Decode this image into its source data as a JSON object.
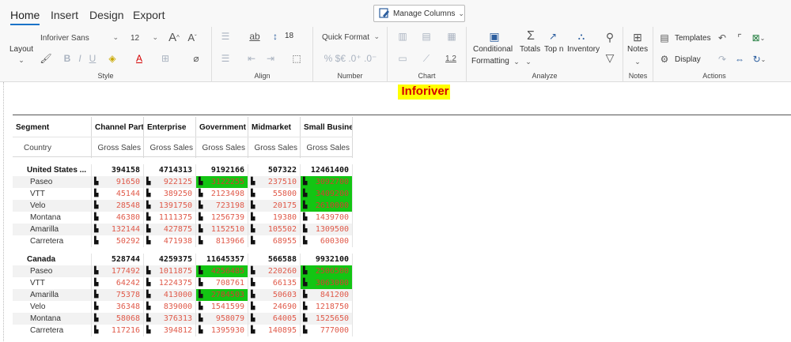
{
  "tabs": [
    "Home",
    "Insert",
    "Design",
    "Export"
  ],
  "manage_columns": "Manage Columns",
  "ribbon": {
    "layout_label": "Layout",
    "font_name": "Inforiver Sans",
    "font_size": "12",
    "line_height": "18",
    "quick_format": "Quick Format",
    "conditional_formatting": [
      "Conditional",
      "Formatting"
    ],
    "totals": "Totals",
    "topn": "Top n",
    "inventory": "Inventory",
    "notes": "Notes",
    "templates": "Templates",
    "display": "Display",
    "groups": [
      "Style",
      "Align",
      "Number",
      "Chart",
      "Analyze",
      "Notes",
      "Actions"
    ],
    "number_symbols": "% $€ .0⁺ .0⁻",
    "chart_ratio": "1.2"
  },
  "report_title": "Inforiver",
  "colors": {
    "accent": "#1a73c8",
    "title_red": "#d40000",
    "title_bg": "#ffff00",
    "highlight": "#13c513",
    "value_red": "#e05a4a"
  },
  "table": {
    "row_header": "Segment",
    "row_subheader": "Country",
    "columns": [
      "Channel Partners",
      "Enterprise",
      "Government",
      "Midmarket",
      "Small Business"
    ],
    "measure": "Gross Sales",
    "groups": [
      {
        "name": "United States ...",
        "totals": [
          "394158",
          "4714313",
          "9192166",
          "507322",
          "12461400"
        ],
        "rows": [
          {
            "label": "Paseo",
            "values": [
              "91650",
              "922125",
              "3122255",
              "237510",
              "3092700"
            ]
          },
          {
            "label": "VTT",
            "values": [
              "45144",
              "389250",
              "2123498",
              "55800",
              "3409200"
            ]
          },
          {
            "label": "Velo",
            "values": [
              "28548",
              "1391750",
              "723198",
              "20175",
              "2610000"
            ]
          },
          {
            "label": "Montana",
            "values": [
              "46380",
              "1111375",
              "1256739",
              "19380",
              "1439700"
            ]
          },
          {
            "label": "Amarilla",
            "values": [
              "132144",
              "427875",
              "1152510",
              "105502",
              "1309500"
            ]
          },
          {
            "label": "Carretera",
            "values": [
              "50292",
              "471938",
              "813966",
              "68955",
              "600300"
            ]
          }
        ]
      },
      {
        "name": "Canada",
        "totals": [
          "528744",
          "4259375",
          "11645357",
          "566588",
          "9932100"
        ],
        "rows": [
          {
            "label": "Paseo",
            "values": [
              "177492",
              "1011875",
              "4256485",
              "220260",
              "2506500"
            ]
          },
          {
            "label": "VTT",
            "values": [
              "64242",
              "1224375",
              "708761",
              "66135",
              "3063000"
            ]
          },
          {
            "label": "Amarilla",
            "values": [
              "75378",
              "413000",
              "2784503",
              "50603",
              "841200"
            ]
          },
          {
            "label": "Velo",
            "values": [
              "36348",
              "839000",
              "1541599",
              "24690",
              "1218750"
            ]
          },
          {
            "label": "Montana",
            "values": [
              "58068",
              "376313",
              "958079",
              "64005",
              "1525650"
            ]
          },
          {
            "label": "Carretera",
            "values": [
              "117216",
              "394812",
              "1395930",
              "140895",
              "777000"
            ]
          }
        ]
      }
    ]
  }
}
